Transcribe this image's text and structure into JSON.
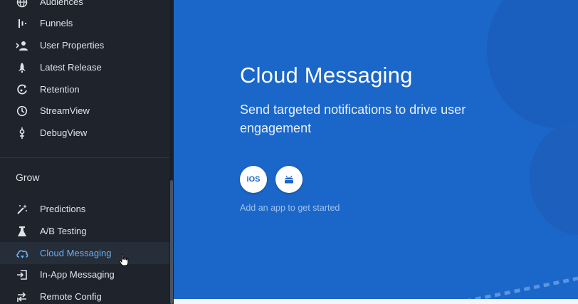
{
  "sidebar": {
    "items_top": [
      {
        "label": "Audiences",
        "icon": "globe-icon"
      },
      {
        "label": "Funnels",
        "icon": "funnels-icon"
      },
      {
        "label": "User Properties",
        "icon": "user-properties-icon"
      },
      {
        "label": "Latest Release",
        "icon": "rocket-icon"
      },
      {
        "label": "Retention",
        "icon": "retention-icon"
      },
      {
        "label": "StreamView",
        "icon": "clock-icon"
      },
      {
        "label": "DebugView",
        "icon": "debug-icon"
      }
    ],
    "section_title": "Grow",
    "items_grow": [
      {
        "label": "Predictions",
        "icon": "magic-wand-icon"
      },
      {
        "label": "A/B Testing",
        "icon": "flask-icon"
      },
      {
        "label": "Cloud Messaging",
        "icon": "cloud-messaging-icon",
        "active": true
      },
      {
        "label": "In-App Messaging",
        "icon": "in-app-messaging-icon"
      },
      {
        "label": "Remote Config",
        "icon": "remote-config-icon"
      }
    ]
  },
  "main": {
    "title": "Cloud Messaging",
    "subtitle": "Send targeted notifications to drive user engagement",
    "ios_label": "iOS",
    "hint": "Add an app to get started"
  },
  "colors": {
    "sidebar_bg": "#1e232c",
    "active_accent": "#6ab0f3",
    "hero_bg": "#1b67c9"
  }
}
